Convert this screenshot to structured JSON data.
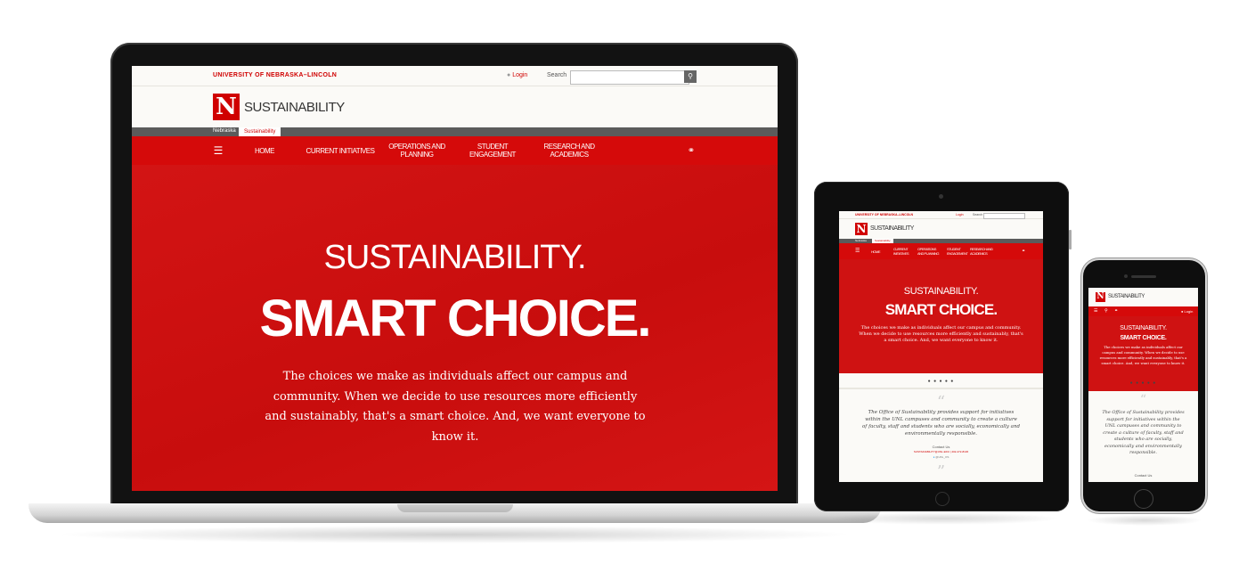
{
  "colors": {
    "brand_red": "#d00000",
    "nav_red": "#d50a0a",
    "hero_red": "#cf1212",
    "crumb_gray": "#5b5b5b"
  },
  "icons": {
    "login": "user-icon",
    "search": "search-icon",
    "menu": "hamburger-icon",
    "share": "share-icon",
    "twitter": "twitter-icon"
  },
  "laptop": {
    "university": "UNIVERSITY OF NEBRASKA–LINCOLN",
    "login": "Login",
    "search_label": "Search",
    "logo_letter": "N",
    "site_title": "SUSTAINABILITY",
    "breadcrumbs": [
      "Nebraska",
      "Sustainability"
    ],
    "nav": [
      {
        "label": "HOME"
      },
      {
        "label": "CURRENT INITIATIVES"
      },
      {
        "label": "OPERATIONS AND PLANNING"
      },
      {
        "label": "STUDENT ENGAGEMENT"
      },
      {
        "label": "RESEARCH AND ACADEMICS"
      }
    ],
    "hero": {
      "headline": "SUSTAINABILITY.",
      "subheadline": "SMART CHOICE.",
      "body": "The choices we make as individuals affect our campus and community. When we decide to use resources more efficiently and sustainably, that's a smart choice. And, we want everyone to know it."
    }
  },
  "tablet": {
    "university": "UNIVERSITY OF NEBRASKA–LINCOLN",
    "login": "Login",
    "search_label": "Search",
    "logo_letter": "N",
    "site_title": "SUSTAINABILITY",
    "breadcrumbs": [
      "Nebraska",
      "Sustainability"
    ],
    "nav": [
      {
        "label": "HOME"
      },
      {
        "label": "CURRENT INITIATIVES"
      },
      {
        "label": "OPERATIONS AND PLANNING"
      },
      {
        "label": "STUDENT ENGAGEMENT"
      },
      {
        "label": "RESEARCH AND ACADEMICS"
      }
    ],
    "hero": {
      "headline": "SUSTAINABILITY.",
      "subheadline": "SMART CHOICE.",
      "body": "The choices we make as individuals affect our campus and community. When we decide to use resources more efficiently and sustainably, that's a smart choice. And, we want everyone to know it."
    },
    "dots": "● ● ● ● ●",
    "quote_mark_open": "“",
    "quote": "The Office of Sustainability provides support for initiatives within the UNL campuses and community to create a culture of faculty, staff and students who are socially, economically and environmentally responsible.",
    "contact_label": "Contact Us",
    "contact_info": "SUSTAINABILITY@UNL.EDU | 402-472-8136",
    "twitter": "@UNL_OS",
    "quote_mark_close": "”"
  },
  "phone": {
    "logo_letter": "N",
    "site_title": "SUSTAINABILITY",
    "login": "Login",
    "hero": {
      "headline": "SUSTAINABILITY.",
      "subheadline": "SMART CHOICE.",
      "body": "The choices we make as individuals affect our campus and community. When we decide to use resources more efficiently and sustainably, that's a smart choice. And, we want everyone to know it."
    },
    "dots": "● ● ● ● ●",
    "quote_mark_open": "“",
    "quote": "The Office of Sustainability provides support for initiatives within the UNL campuses and community to create a culture of faculty, staff and students who are socially, economically and environmentally responsible.",
    "contact_label": "Contact Us"
  }
}
